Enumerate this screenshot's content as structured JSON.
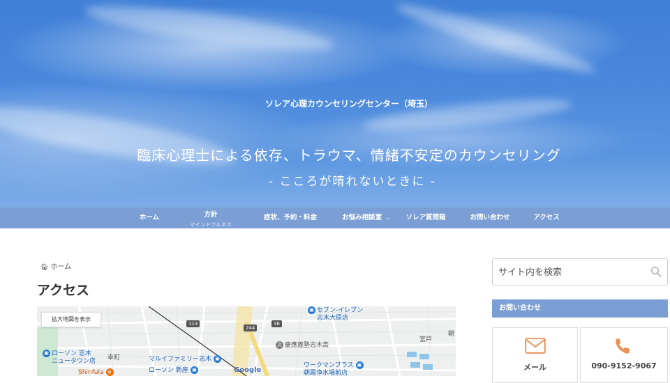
{
  "header": {
    "site_title": "ソレア心理カウンセリングセンター（埼玉）",
    "tagline": "臨床心理士による依存、トラウマ、情緒不安定のカウンセリング",
    "subline": "- こころが晴れないときに -"
  },
  "nav": {
    "items": [
      {
        "label": "ホーム"
      },
      {
        "label": "方針",
        "sub": "マインドフルネス"
      },
      {
        "label": "症状、予約・料金"
      },
      {
        "label": "お悩み相談室",
        "chevron": "⌄"
      },
      {
        "label": "ソレア質問箱"
      },
      {
        "label": "お問い合わせ"
      },
      {
        "label": "アクセス"
      }
    ]
  },
  "breadcrumb": {
    "home": "ホーム",
    "icon": "home-icon"
  },
  "page": {
    "title": "アクセス"
  },
  "map": {
    "enlarge_button": "拡大地図を表示",
    "road_113": "113",
    "road_244": "244",
    "road_36": "36",
    "poi_seven_1": "セブン-イレブン",
    "poi_seven_2": "志木大原店",
    "poi_lawson_1": "ローソン 志木",
    "poi_lawson_2": "ニュータウン店",
    "poi_maruifamily": "マルイファミリー志木",
    "poi_lawson_shinza": "ローソン 新座",
    "poi_keio": "慶應義塾志木高",
    "poi_workman_1": "ワークマンプラス",
    "poi_workman_2": "朝霞浄水場前店",
    "place_saiwai": "幸町",
    "place_miyato": "宮戸",
    "place_asa": "朝",
    "poi_shinfula": "Shinfula",
    "google_logo": "Google"
  },
  "sidebar": {
    "search_placeholder": "サイト内を検索",
    "contact_title": "お問い合わせ",
    "mail_label": "メール",
    "phone_label": "090-9152-9067"
  },
  "colors": {
    "nav_bg": "#7b9fd4",
    "accent_orange": "#e8935a"
  }
}
